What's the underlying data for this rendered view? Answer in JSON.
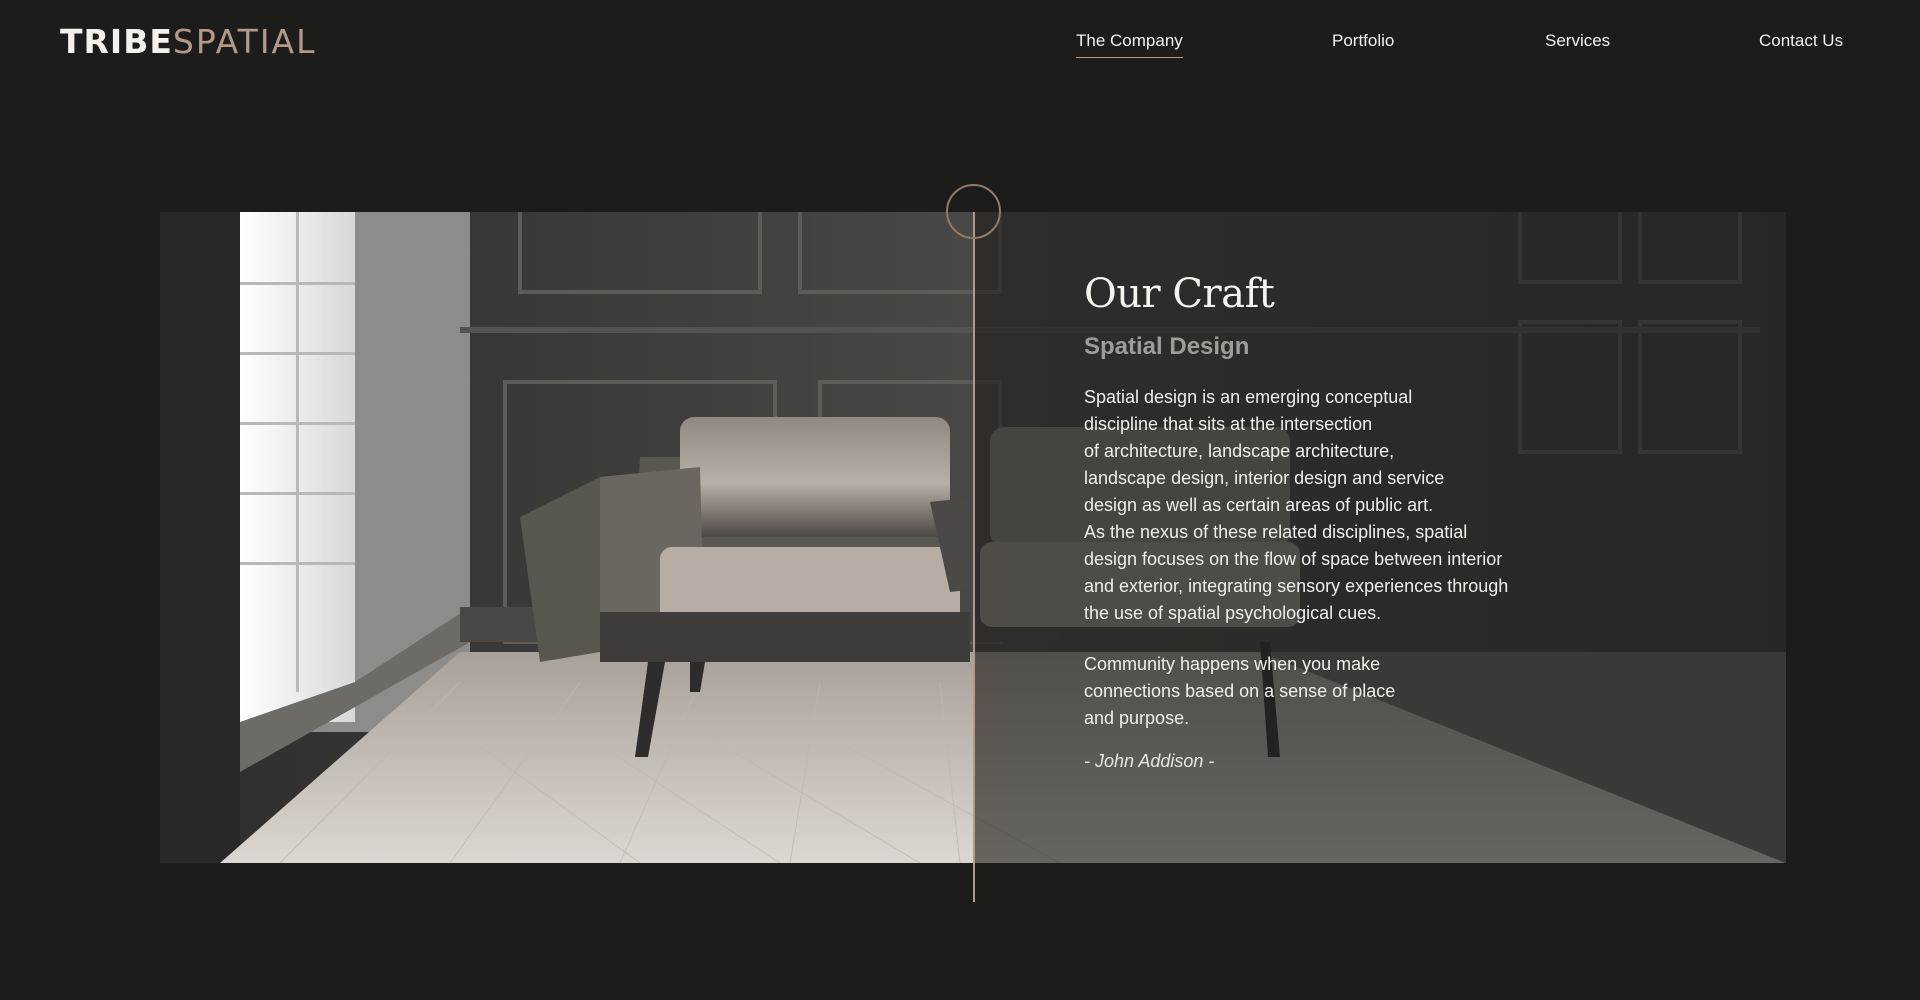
{
  "brand": {
    "logo_part1": "TRIBE",
    "logo_part2": "SPATIAL"
  },
  "nav": {
    "items": [
      {
        "label": "The Company",
        "active": true
      },
      {
        "label": "Portfolio",
        "active": false
      },
      {
        "label": "Services",
        "active": false
      },
      {
        "label": "Contact Us",
        "active": false
      }
    ]
  },
  "hero": {
    "title": "Our Craft",
    "subtitle": "Spatial Design",
    "body_lines": [
      "Spatial design is an emerging conceptual",
      "discipline that sits at the intersection",
      "of architecture, landscape architecture,",
      "landscape design, interior design and service",
      "design as well as certain areas of public art.",
      "As the nexus of these related disciplines, spatial",
      "design focuses on the flow of space between interior",
      "and exterior, integrating sensory experiences through",
      "the use of spatial psychological cues."
    ],
    "quote_lines": [
      "Community happens when you make",
      "connections based on a sense of place",
      "and purpose."
    ],
    "author": "- John Addison -"
  },
  "colors": {
    "background": "#1c1c1b",
    "accent": "#b3998a",
    "text": "#f2efea",
    "muted": "#a09b96"
  }
}
